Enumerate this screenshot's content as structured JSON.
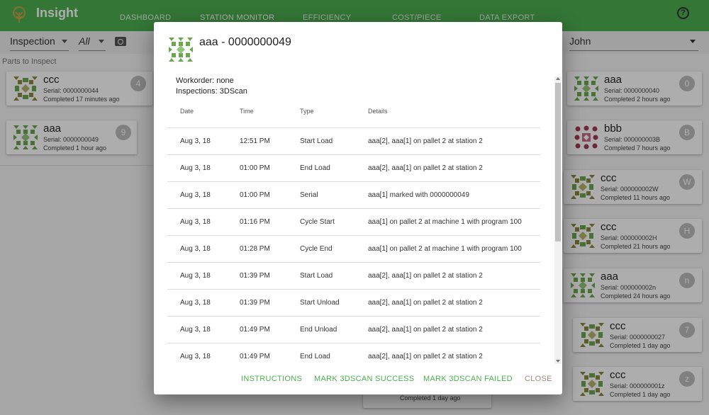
{
  "app": {
    "title": "Insight"
  },
  "nav": {
    "tabs": [
      "DASHBOARD",
      "STATION MONITOR",
      "EFFICIENCY",
      "COST/PIECE",
      "DATA EXPORT"
    ],
    "active": "STATION MONITOR"
  },
  "toolbar": {
    "mode": "Inspection",
    "filter": "All",
    "user": "John"
  },
  "left": {
    "section_label": "Parts to Inspect"
  },
  "cards": [
    {
      "name": "ccc",
      "serial": "Serial: 0000000044",
      "completed": "Completed 17 minutes ago",
      "badge": "4"
    },
    {
      "name": "aaa",
      "serial": "Serial: 0000000049",
      "completed": "Completed 1 hour ago",
      "badge": "9"
    },
    {
      "name": "aaa",
      "serial": "Serial: 0000000040",
      "completed": "Completed 2 hours ago",
      "badge": "0"
    },
    {
      "name": "bbb",
      "serial": "Serial: 000000003B",
      "completed": "Completed 7 hours ago",
      "badge": "B"
    },
    {
      "name": "ccc",
      "serial": "Serial: 000000002W",
      "completed": "Completed 11 hours ago",
      "badge": "W"
    },
    {
      "name": "ccc",
      "serial": "Serial: 000000002H",
      "completed": "Completed 21 hours ago",
      "badge": "H"
    },
    {
      "name": "aaa",
      "serial": "Serial: 000000002n",
      "completed": "Completed 24 hours ago",
      "badge": "n"
    },
    {
      "name": "ccc",
      "serial": "Serial: 0000000027",
      "completed": "Completed 1 day ago",
      "badge": "7"
    },
    {
      "name": "ccc",
      "serial": "Serial: 000000001z",
      "completed": "Completed 1 day ago",
      "badge": "z"
    },
    {
      "name": "",
      "serial": "",
      "completed": "Completed 1 day ago",
      "badge": ""
    }
  ],
  "dialog": {
    "title": "aaa - 0000000049",
    "workorder": "Workorder: none",
    "inspections": "Inspections: 3DScan",
    "columns": [
      "Date",
      "Time",
      "Type",
      "Details"
    ],
    "rows": [
      {
        "date": "Aug 3, 18",
        "time": "12:51 PM",
        "type": "Start Load",
        "details": "aaa[2], aaa[1] on pallet 2 at station 2"
      },
      {
        "date": "Aug 3, 18",
        "time": "01:00 PM",
        "type": "End Load",
        "details": "aaa[2], aaa[1] on pallet 2 at station 2"
      },
      {
        "date": "Aug 3, 18",
        "time": "01:00 PM",
        "type": "Serial",
        "details": "aaa[1] marked with 0000000049"
      },
      {
        "date": "Aug 3, 18",
        "time": "01:16 PM",
        "type": "Cycle Start",
        "details": "aaa[1] on pallet 2 at machine 1 with program 100"
      },
      {
        "date": "Aug 3, 18",
        "time": "01:28 PM",
        "type": "Cycle End",
        "details": "aaa[1] on pallet 2 at machine 1 with program 100"
      },
      {
        "date": "Aug 3, 18",
        "time": "01:39 PM",
        "type": "Start Load",
        "details": "aaa[2], aaa[1] on pallet 2 at station 2"
      },
      {
        "date": "Aug 3, 18",
        "time": "01:39 PM",
        "type": "Start Unload",
        "details": "aaa[2], aaa[1] on pallet 2 at station 2"
      },
      {
        "date": "Aug 3, 18",
        "time": "01:49 PM",
        "type": "End Unload",
        "details": "aaa[2], aaa[1] on pallet 2 at station 2"
      },
      {
        "date": "Aug 3, 18",
        "time": "01:49 PM",
        "type": "End Load",
        "details": "aaa[2], aaa[1] on pallet 2 at station 2"
      }
    ],
    "actions": {
      "instructions": "INSTRUCTIONS",
      "success": "MARK 3DSCAN SUCCESS",
      "failed": "MARK 3DSCAN FAILED",
      "close": "CLOSE"
    }
  },
  "colors": {
    "primary": "#4caf50",
    "badge": "#bdbdbd",
    "close": "#a1887f"
  }
}
